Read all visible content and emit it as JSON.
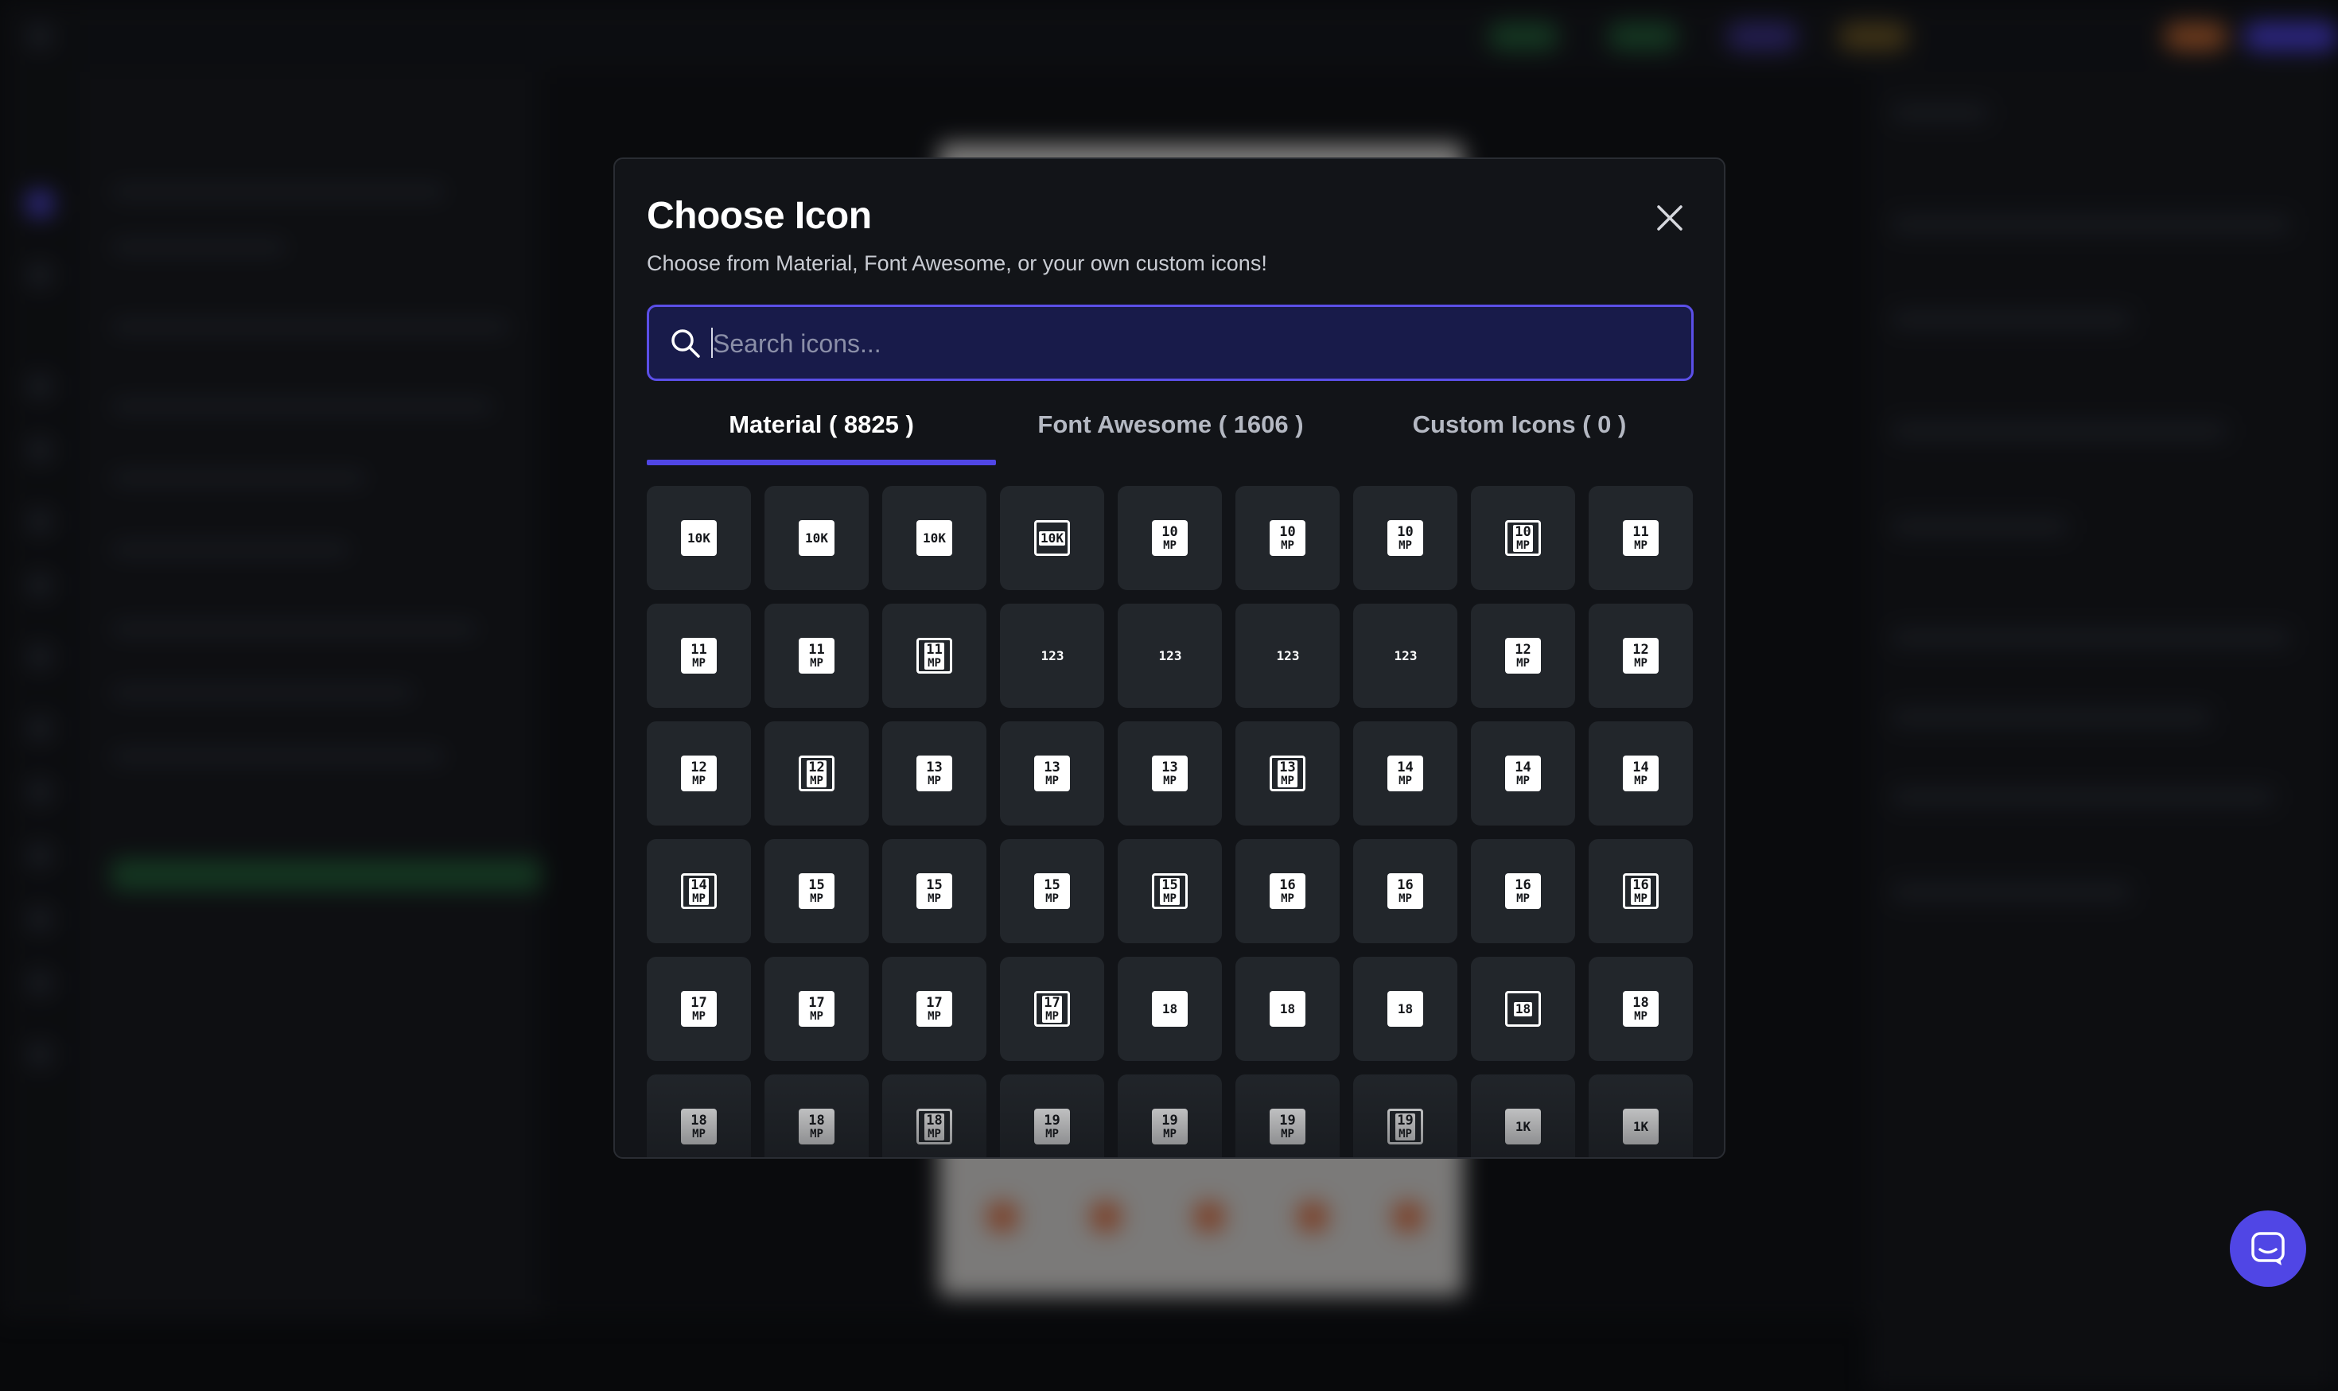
{
  "modal": {
    "title": "Choose Icon",
    "subtitle": "Choose from Material, Font Awesome, or your own custom icons!",
    "close_icon": "close-icon"
  },
  "search": {
    "placeholder": "Search icons...",
    "value": "",
    "icon": "search-icon"
  },
  "tabs": [
    {
      "label": "Material ( 8825 )",
      "active": true
    },
    {
      "label": "Font Awesome ( 1606 )",
      "active": false
    },
    {
      "label": "Custom Icons ( 0 )",
      "active": false
    }
  ],
  "icons": [
    {
      "l1": "10K",
      "l2": "",
      "style": "solid"
    },
    {
      "l1": "10K",
      "l2": "",
      "style": "solid"
    },
    {
      "l1": "10K",
      "l2": "",
      "style": "solid"
    },
    {
      "l1": "10K",
      "l2": "",
      "style": "outline"
    },
    {
      "l1": "10",
      "l2": "MP",
      "style": "solid"
    },
    {
      "l1": "10",
      "l2": "MP",
      "style": "solid"
    },
    {
      "l1": "10",
      "l2": "MP",
      "style": "solid"
    },
    {
      "l1": "10",
      "l2": "MP",
      "style": "outline"
    },
    {
      "l1": "11",
      "l2": "MP",
      "style": "solid"
    },
    {
      "l1": "11",
      "l2": "MP",
      "style": "solid"
    },
    {
      "l1": "11",
      "l2": "MP",
      "style": "solid"
    },
    {
      "l1": "11",
      "l2": "MP",
      "style": "outline"
    },
    {
      "l1": "123",
      "l2": "",
      "style": "plain"
    },
    {
      "l1": "123",
      "l2": "",
      "style": "plain"
    },
    {
      "l1": "123",
      "l2": "",
      "style": "plain"
    },
    {
      "l1": "123",
      "l2": "",
      "style": "plain"
    },
    {
      "l1": "12",
      "l2": "MP",
      "style": "solid"
    },
    {
      "l1": "12",
      "l2": "MP",
      "style": "solid"
    },
    {
      "l1": "12",
      "l2": "MP",
      "style": "solid"
    },
    {
      "l1": "12",
      "l2": "MP",
      "style": "outline"
    },
    {
      "l1": "13",
      "l2": "MP",
      "style": "solid"
    },
    {
      "l1": "13",
      "l2": "MP",
      "style": "solid"
    },
    {
      "l1": "13",
      "l2": "MP",
      "style": "solid"
    },
    {
      "l1": "13",
      "l2": "MP",
      "style": "outline"
    },
    {
      "l1": "14",
      "l2": "MP",
      "style": "solid"
    },
    {
      "l1": "14",
      "l2": "MP",
      "style": "solid"
    },
    {
      "l1": "14",
      "l2": "MP",
      "style": "solid"
    },
    {
      "l1": "14",
      "l2": "MP",
      "style": "outline"
    },
    {
      "l1": "15",
      "l2": "MP",
      "style": "solid"
    },
    {
      "l1": "15",
      "l2": "MP",
      "style": "solid"
    },
    {
      "l1": "15",
      "l2": "MP",
      "style": "solid"
    },
    {
      "l1": "15",
      "l2": "MP",
      "style": "outline"
    },
    {
      "l1": "16",
      "l2": "MP",
      "style": "solid"
    },
    {
      "l1": "16",
      "l2": "MP",
      "style": "solid"
    },
    {
      "l1": "16",
      "l2": "MP",
      "style": "solid"
    },
    {
      "l1": "16",
      "l2": "MP",
      "style": "outline"
    },
    {
      "l1": "17",
      "l2": "MP",
      "style": "solid"
    },
    {
      "l1": "17",
      "l2": "MP",
      "style": "solid"
    },
    {
      "l1": "17",
      "l2": "MP",
      "style": "solid"
    },
    {
      "l1": "17",
      "l2": "MP",
      "style": "outline"
    },
    {
      "l1": "18",
      "l2": "",
      "style": "solid"
    },
    {
      "l1": "18",
      "l2": "",
      "style": "solid"
    },
    {
      "l1": "18",
      "l2": "",
      "style": "solid"
    },
    {
      "l1": "18",
      "l2": "",
      "style": "outline"
    },
    {
      "l1": "18",
      "l2": "MP",
      "style": "solid"
    },
    {
      "l1": "18",
      "l2": "MP",
      "style": "solid"
    },
    {
      "l1": "18",
      "l2": "MP",
      "style": "solid"
    },
    {
      "l1": "18",
      "l2": "MP",
      "style": "outline"
    },
    {
      "l1": "19",
      "l2": "MP",
      "style": "solid"
    },
    {
      "l1": "19",
      "l2": "MP",
      "style": "solid"
    },
    {
      "l1": "19",
      "l2": "MP",
      "style": "solid"
    },
    {
      "l1": "19",
      "l2": "MP",
      "style": "outline"
    },
    {
      "l1": "1K",
      "l2": "",
      "style": "solid"
    },
    {
      "l1": "1K",
      "l2": "",
      "style": "solid"
    }
  ],
  "chat": {
    "icon": "chat-bubble-icon"
  },
  "colors": {
    "accent": "#5046e5",
    "modal_bg": "#121418",
    "tile_bg": "#22262b",
    "search_bg": "#181b4a"
  }
}
